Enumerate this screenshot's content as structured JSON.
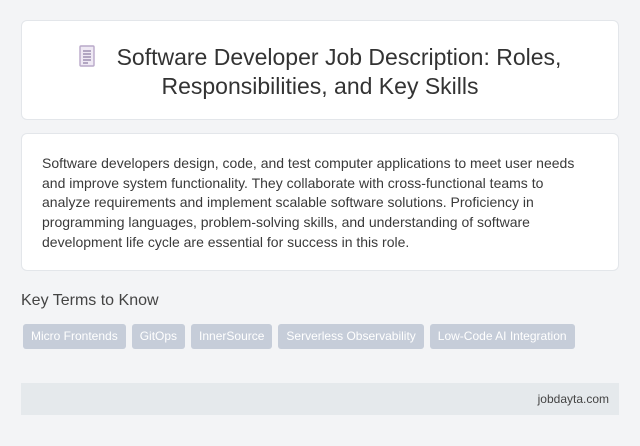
{
  "header": {
    "icon": "document-icon",
    "title": "Software Developer Job Description: Roles, Responsibilities, and Key Skills"
  },
  "summary": {
    "text": "Software developers design, code, and test computer applications to meet user needs and improve system functionality. They collaborate with cross-functional teams to analyze requirements and implement scalable software solutions. Proficiency in programming languages, problem-solving skills, and understanding of software development life cycle are essential for success in this role."
  },
  "key_terms": {
    "heading": "Key Terms to Know",
    "tags": [
      "Micro Frontends",
      "GitOps",
      "InnerSource",
      "Serverless Observability",
      "Low-Code AI Integration"
    ]
  },
  "footer": {
    "site": "jobdayta.com"
  },
  "colors": {
    "tag_background": "#c6cdd9",
    "footer_background": "#e5e9ec",
    "icon_color": "#b9a9c9"
  }
}
